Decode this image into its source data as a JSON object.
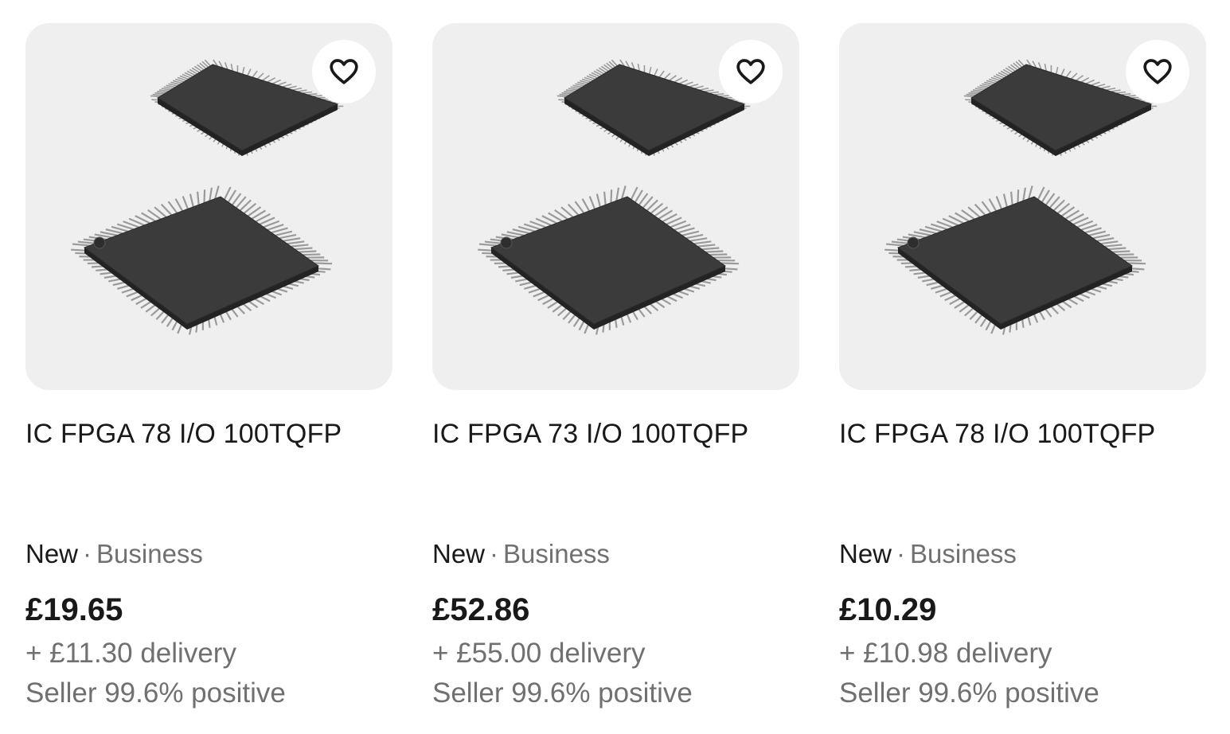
{
  "listings": [
    {
      "image_alt": "IC FPGA 78 I/O 100TQFP",
      "title": "IC FPGA 78 I/O 100TQFP",
      "condition": "New",
      "separator": "·",
      "seller_type": "Business",
      "price": "£19.65",
      "delivery": "+ £11.30 delivery",
      "seller_feedback": "Seller 99.6% positive",
      "watch_icon": "heart-outline"
    },
    {
      "image_alt": "IC FPGA 73 I/O 100TQFP",
      "title": "IC FPGA 73 I/O 100TQFP",
      "condition": "New",
      "separator": "·",
      "seller_type": "Business",
      "price": "£52.86",
      "delivery": "+ £55.00 delivery",
      "seller_feedback": "Seller 99.6% positive",
      "watch_icon": "heart-outline"
    },
    {
      "image_alt": "IC FPGA 78 I/O 100TQFP",
      "title": "IC FPGA 78 I/O 100TQFP",
      "condition": "New",
      "separator": "·",
      "seller_type": "Business",
      "price": "£10.29",
      "delivery": "+ £10.98 delivery",
      "seller_feedback": "Seller 99.6% positive",
      "watch_icon": "heart-outline"
    }
  ],
  "colors": {
    "text_primary": "#191919",
    "text_secondary": "#707070",
    "image_background": "#efefef",
    "chip_body": "#3b3b3b",
    "chip_leads": "#9a9a9a"
  }
}
